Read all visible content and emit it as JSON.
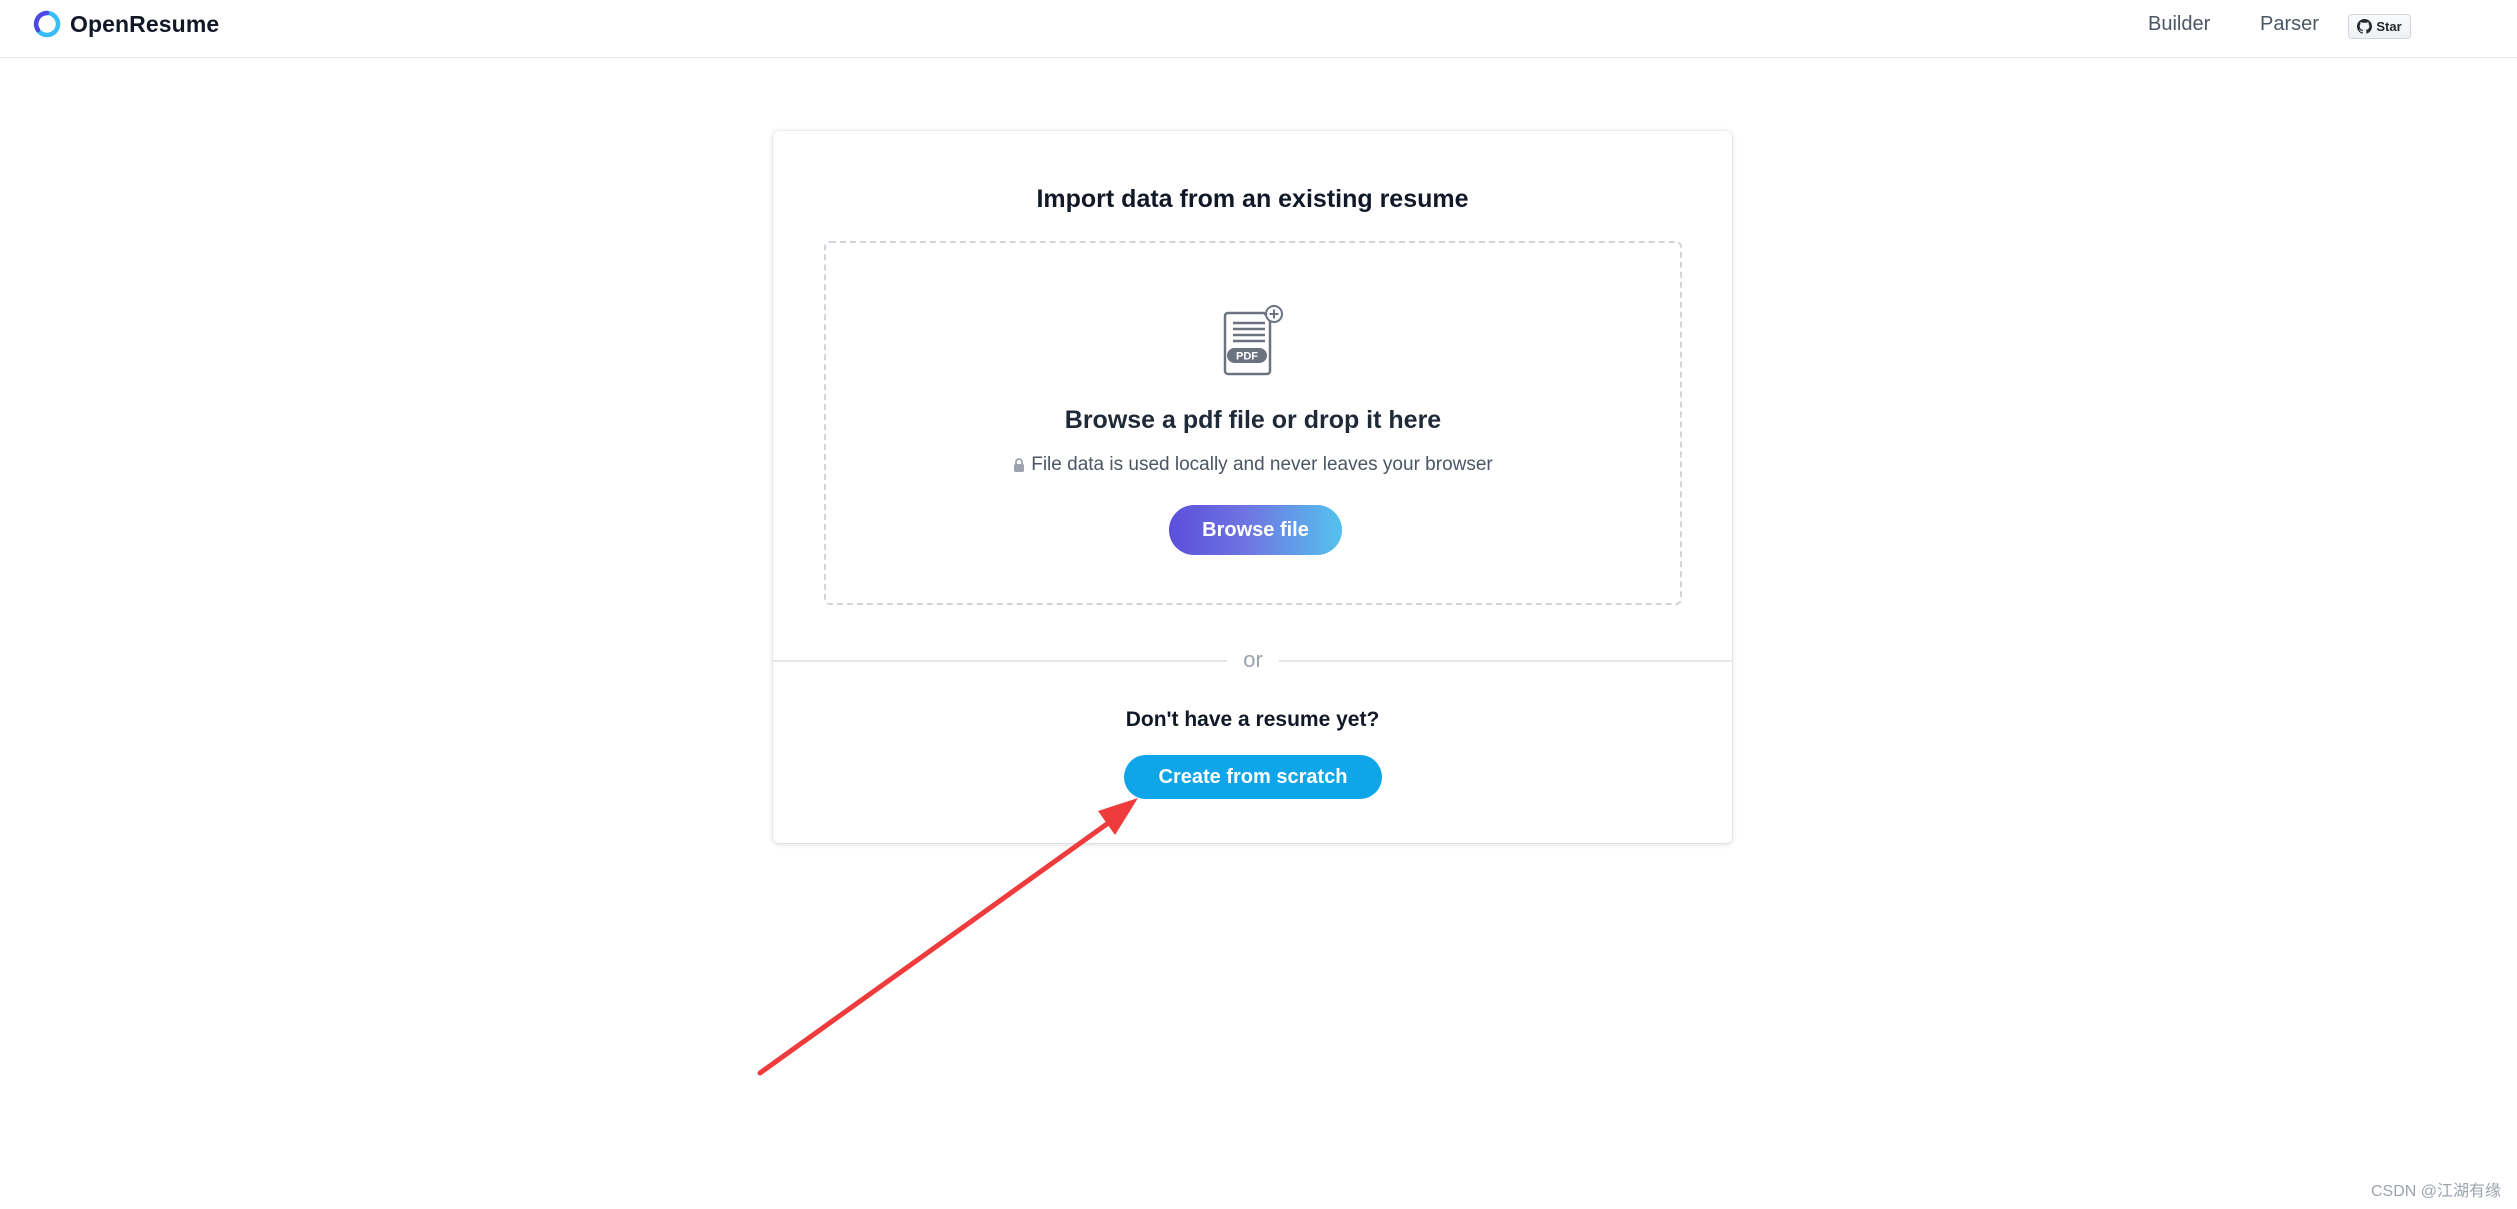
{
  "header": {
    "brand": "OpenResume",
    "nav": {
      "builder": "Builder",
      "parser": "Parser"
    },
    "github_star_label": "Star"
  },
  "card": {
    "title": "Import data from an existing resume",
    "dropzone": {
      "icon_label": "PDF",
      "title": "Browse a pdf file or drop it here",
      "privacy_note": "File data is used locally and never leaves your browser",
      "browse_button": "Browse file"
    },
    "divider": "or",
    "no_resume_prompt": "Don't have a resume yet?",
    "create_button": "Create from scratch"
  },
  "watermark": "CSDN @江湖有缘",
  "colors": {
    "brand_blue": "#0ea5e9",
    "browse_gradient_start": "#5b4fdb",
    "browse_gradient_end": "#54c2ee",
    "arrow_red": "#ef3b3b"
  },
  "icons": [
    "openresume-logo-icon",
    "github-icon",
    "pdf-file-plus-icon",
    "lock-icon",
    "red-arrow-annotation"
  ]
}
